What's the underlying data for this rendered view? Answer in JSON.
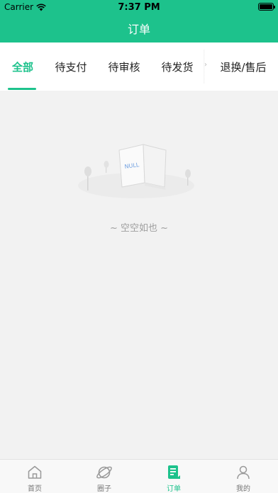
{
  "status_bar": {
    "carrier": "Carrier",
    "time": "7:37 PM"
  },
  "nav": {
    "title": "订单"
  },
  "tabs": [
    {
      "label": "全部",
      "active": true
    },
    {
      "label": "待支付",
      "active": false
    },
    {
      "label": "待审核",
      "active": false
    },
    {
      "label": "待发货",
      "active": false
    },
    {
      "label": "退换/售后",
      "active": false
    }
  ],
  "empty": {
    "illustration_text": "NULL",
    "message": "~ 空空如也 ~"
  },
  "tabbar": [
    {
      "label": "首页",
      "icon": "home-icon",
      "active": false
    },
    {
      "label": "圈子",
      "icon": "planet-icon",
      "active": false
    },
    {
      "label": "订单",
      "icon": "order-icon",
      "active": true
    },
    {
      "label": "我的",
      "icon": "profile-icon",
      "active": false
    }
  ],
  "colors": {
    "accent": "#1dc28c",
    "background": "#f2f2f2",
    "inactive": "#777777"
  }
}
